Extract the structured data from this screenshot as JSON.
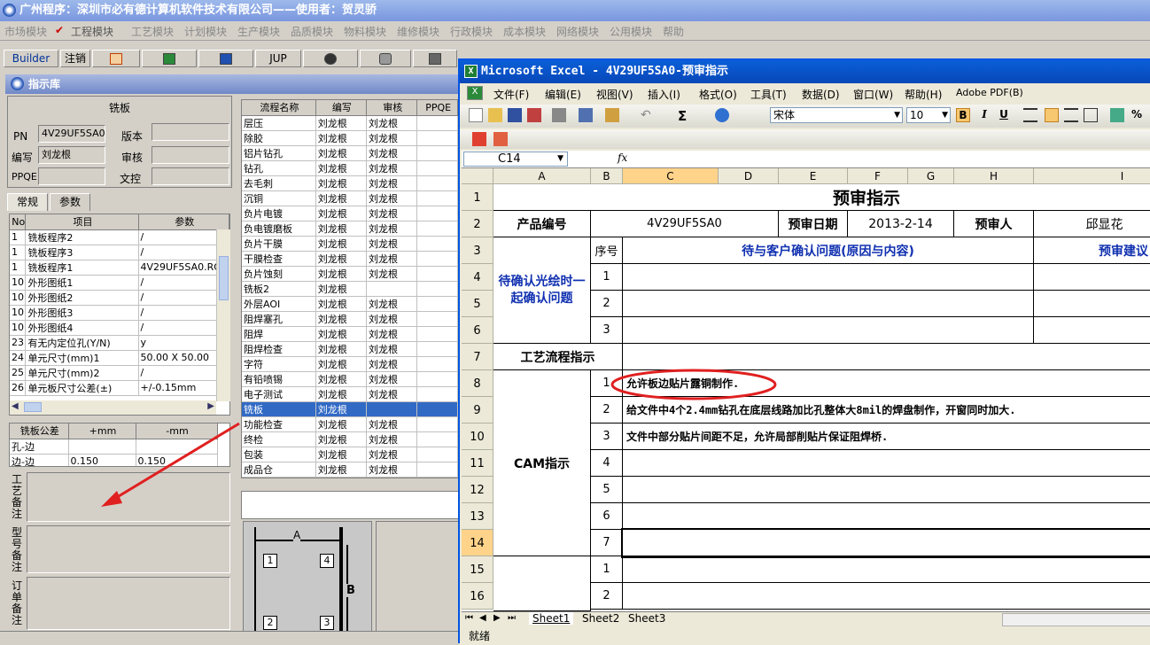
{
  "app": {
    "title": "广州程序：深圳市必有德计算机软件技术有限公司——使用者：贺灵骄"
  },
  "menu": [
    "市场模块",
    "工程模块",
    "工艺模块",
    "计划模块",
    "生产模块",
    "品质模块",
    "物料模块",
    "维修模块",
    "行政模块",
    "成本模块",
    "网络模块",
    "公用模块",
    "帮助"
  ],
  "toolbar": {
    "builder": "Builder",
    "logout": "注销",
    "jup": "JUP"
  },
  "panel": {
    "title": "指示库",
    "group_title": "铣板",
    "pn_label": "PN",
    "pn_value": "4V29UF5SA0",
    "version_label": "版本",
    "author_label": "编写",
    "author_value": "刘龙根",
    "review_label": "审核",
    "ppqe_label": "PPQE",
    "doc_label": "文控",
    "tabs": [
      "常规",
      "参数"
    ],
    "params_headers": [
      "No",
      "项目",
      "参数"
    ],
    "params": [
      [
        "1",
        "铣板程序2",
        "/"
      ],
      [
        "1",
        "铣板程序3",
        "/"
      ],
      [
        "1",
        "铣板程序1",
        "4V29UF5SA0.ROU"
      ],
      [
        "10",
        "外形图纸1",
        "/"
      ],
      [
        "10",
        "外形图纸2",
        "/"
      ],
      [
        "10",
        "外形图纸3",
        "/"
      ],
      [
        "10",
        "外形图纸4",
        "/"
      ],
      [
        "23",
        "有无内定位孔(Y/N)",
        "y"
      ],
      [
        "24",
        "单元尺寸(mm)1",
        "50.00 X 50.00"
      ],
      [
        "25",
        "单元尺寸(mm)2",
        "/"
      ],
      [
        "26",
        "单元板尺寸公差(±)",
        "+/-0.15mm"
      ]
    ],
    "tol_headers": [
      "铣板公差",
      "+mm",
      "-mm"
    ],
    "tolerances": [
      [
        "孔-边",
        "",
        ""
      ],
      [
        "边-边",
        "0.150",
        "0.150"
      ]
    ],
    "note_labels": [
      "工艺备注",
      "型号备注",
      "订单备注"
    ],
    "flow_headers": [
      "流程名称",
      "编写",
      "审核",
      "PPQE"
    ],
    "flow": [
      [
        "层压",
        "刘龙根",
        "刘龙根"
      ],
      [
        "除胶",
        "刘龙根",
        "刘龙根"
      ],
      [
        "铝片钻孔",
        "刘龙根",
        "刘龙根"
      ],
      [
        "钻孔",
        "刘龙根",
        "刘龙根"
      ],
      [
        "去毛刺",
        "刘龙根",
        "刘龙根"
      ],
      [
        "沉铜",
        "刘龙根",
        "刘龙根"
      ],
      [
        "负片电镀",
        "刘龙根",
        "刘龙根"
      ],
      [
        "负电镀磨板",
        "刘龙根",
        "刘龙根"
      ],
      [
        "负片干膜",
        "刘龙根",
        "刘龙根"
      ],
      [
        "干膜检查",
        "刘龙根",
        "刘龙根"
      ],
      [
        "负片蚀刻",
        "刘龙根",
        "刘龙根"
      ],
      [
        "铣板2",
        "刘龙根",
        ""
      ],
      [
        "外层AOI",
        "刘龙根",
        "刘龙根"
      ],
      [
        "阻焊塞孔",
        "刘龙根",
        "刘龙根"
      ],
      [
        "阻焊",
        "刘龙根",
        "刘龙根"
      ],
      [
        "阻焊检查",
        "刘龙根",
        "刘龙根"
      ],
      [
        "字符",
        "刘龙根",
        "刘龙根"
      ],
      [
        "有铅喷锡",
        "刘龙根",
        "刘龙根"
      ],
      [
        "电子测试",
        "刘龙根",
        "刘龙根"
      ],
      [
        "铣板",
        "刘龙根",
        ""
      ],
      [
        "功能检查",
        "刘龙根",
        "刘龙根"
      ],
      [
        "终检",
        "刘龙根",
        "刘龙根"
      ],
      [
        "包装",
        "刘龙根",
        "刘龙根"
      ],
      [
        "成品仓",
        "刘龙根",
        "刘龙根"
      ]
    ],
    "diagram": {
      "a": "A",
      "b": "B",
      "n1": "1",
      "n2": "2",
      "n3": "3",
      "n4": "4"
    }
  },
  "excel": {
    "title": "Microsoft Excel - 4V29UF5SA0-预审指示",
    "menu": [
      "文件(F)",
      "编辑(E)",
      "视图(V)",
      "插入(I)",
      "格式(O)",
      "工具(T)",
      "数据(D)",
      "窗口(W)",
      "帮助(H)",
      "Adobe PDF(B)"
    ],
    "font": "宋体",
    "font_size": "10",
    "cell_ref": "C14",
    "fx": "fx",
    "columns": [
      "A",
      "B",
      "C",
      "D",
      "E",
      "F",
      "G",
      "H",
      "I"
    ],
    "rows": [
      "1",
      "2",
      "3",
      "4",
      "5",
      "6",
      "7",
      "8",
      "9",
      "10",
      "11",
      "12",
      "13",
      "14",
      "15",
      "16"
    ],
    "sheet": {
      "title": "预审指示",
      "product_label": "产品编号",
      "product_value": "4V29UF5SA0",
      "date_label": "预审日期",
      "date_value": "2013-2-14",
      "reviewer_label": "预审人",
      "reviewer_value": "邱显花",
      "seq_label": "序号",
      "issue_header": "待与客户确认问题(原因与内容)",
      "advice_header": "预审建议",
      "confirm_label": "待确认光绘时一起确认问题",
      "confirm_nums": [
        "1",
        "2",
        "3"
      ],
      "process_label": "工艺流程指示",
      "cam_label": "CAM指示",
      "cam_nums": [
        "1",
        "2",
        "3",
        "4",
        "5",
        "6",
        "7"
      ],
      "cam_items": [
        "允许板边贴片露铜制作.",
        "给文件中4个2.4mm钻孔在底层线路加比孔整体大8mil的焊盘制作，开窗同时加大.",
        "文件中部分贴片间距不足，允许局部削贴片保证阻焊桥."
      ],
      "last_nums": [
        "1",
        "2"
      ]
    },
    "sheet_tabs": [
      "Sheet1",
      "Sheet2",
      "Sheet3"
    ],
    "status": "就绪"
  }
}
